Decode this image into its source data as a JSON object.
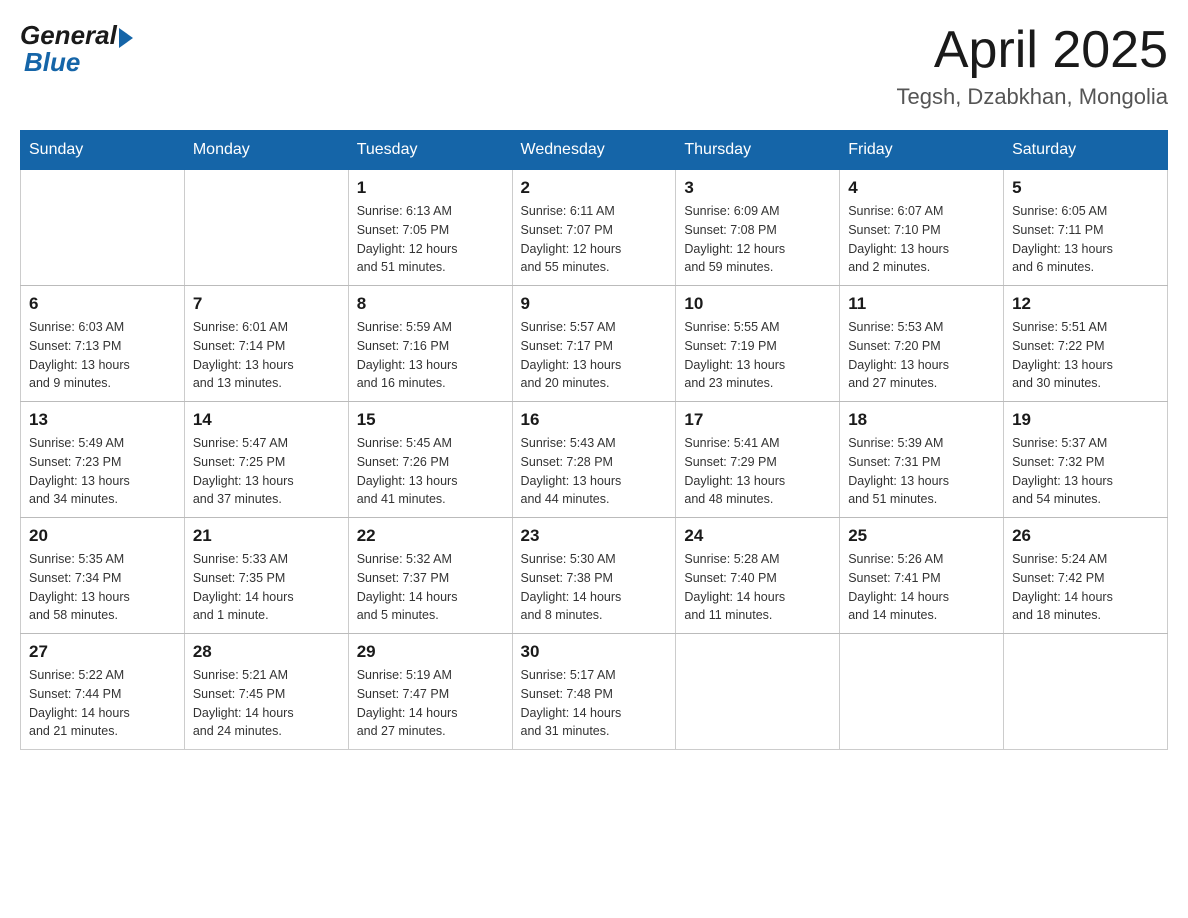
{
  "logo": {
    "general": "General",
    "blue": "Blue"
  },
  "title": "April 2025",
  "location": "Tegsh, Dzabkhan, Mongolia",
  "days_of_week": [
    "Sunday",
    "Monday",
    "Tuesday",
    "Wednesday",
    "Thursday",
    "Friday",
    "Saturday"
  ],
  "weeks": [
    [
      {
        "day": "",
        "info": ""
      },
      {
        "day": "",
        "info": ""
      },
      {
        "day": "1",
        "info": "Sunrise: 6:13 AM\nSunset: 7:05 PM\nDaylight: 12 hours\nand 51 minutes."
      },
      {
        "day": "2",
        "info": "Sunrise: 6:11 AM\nSunset: 7:07 PM\nDaylight: 12 hours\nand 55 minutes."
      },
      {
        "day": "3",
        "info": "Sunrise: 6:09 AM\nSunset: 7:08 PM\nDaylight: 12 hours\nand 59 minutes."
      },
      {
        "day": "4",
        "info": "Sunrise: 6:07 AM\nSunset: 7:10 PM\nDaylight: 13 hours\nand 2 minutes."
      },
      {
        "day": "5",
        "info": "Sunrise: 6:05 AM\nSunset: 7:11 PM\nDaylight: 13 hours\nand 6 minutes."
      }
    ],
    [
      {
        "day": "6",
        "info": "Sunrise: 6:03 AM\nSunset: 7:13 PM\nDaylight: 13 hours\nand 9 minutes."
      },
      {
        "day": "7",
        "info": "Sunrise: 6:01 AM\nSunset: 7:14 PM\nDaylight: 13 hours\nand 13 minutes."
      },
      {
        "day": "8",
        "info": "Sunrise: 5:59 AM\nSunset: 7:16 PM\nDaylight: 13 hours\nand 16 minutes."
      },
      {
        "day": "9",
        "info": "Sunrise: 5:57 AM\nSunset: 7:17 PM\nDaylight: 13 hours\nand 20 minutes."
      },
      {
        "day": "10",
        "info": "Sunrise: 5:55 AM\nSunset: 7:19 PM\nDaylight: 13 hours\nand 23 minutes."
      },
      {
        "day": "11",
        "info": "Sunrise: 5:53 AM\nSunset: 7:20 PM\nDaylight: 13 hours\nand 27 minutes."
      },
      {
        "day": "12",
        "info": "Sunrise: 5:51 AM\nSunset: 7:22 PM\nDaylight: 13 hours\nand 30 minutes."
      }
    ],
    [
      {
        "day": "13",
        "info": "Sunrise: 5:49 AM\nSunset: 7:23 PM\nDaylight: 13 hours\nand 34 minutes."
      },
      {
        "day": "14",
        "info": "Sunrise: 5:47 AM\nSunset: 7:25 PM\nDaylight: 13 hours\nand 37 minutes."
      },
      {
        "day": "15",
        "info": "Sunrise: 5:45 AM\nSunset: 7:26 PM\nDaylight: 13 hours\nand 41 minutes."
      },
      {
        "day": "16",
        "info": "Sunrise: 5:43 AM\nSunset: 7:28 PM\nDaylight: 13 hours\nand 44 minutes."
      },
      {
        "day": "17",
        "info": "Sunrise: 5:41 AM\nSunset: 7:29 PM\nDaylight: 13 hours\nand 48 minutes."
      },
      {
        "day": "18",
        "info": "Sunrise: 5:39 AM\nSunset: 7:31 PM\nDaylight: 13 hours\nand 51 minutes."
      },
      {
        "day": "19",
        "info": "Sunrise: 5:37 AM\nSunset: 7:32 PM\nDaylight: 13 hours\nand 54 minutes."
      }
    ],
    [
      {
        "day": "20",
        "info": "Sunrise: 5:35 AM\nSunset: 7:34 PM\nDaylight: 13 hours\nand 58 minutes."
      },
      {
        "day": "21",
        "info": "Sunrise: 5:33 AM\nSunset: 7:35 PM\nDaylight: 14 hours\nand 1 minute."
      },
      {
        "day": "22",
        "info": "Sunrise: 5:32 AM\nSunset: 7:37 PM\nDaylight: 14 hours\nand 5 minutes."
      },
      {
        "day": "23",
        "info": "Sunrise: 5:30 AM\nSunset: 7:38 PM\nDaylight: 14 hours\nand 8 minutes."
      },
      {
        "day": "24",
        "info": "Sunrise: 5:28 AM\nSunset: 7:40 PM\nDaylight: 14 hours\nand 11 minutes."
      },
      {
        "day": "25",
        "info": "Sunrise: 5:26 AM\nSunset: 7:41 PM\nDaylight: 14 hours\nand 14 minutes."
      },
      {
        "day": "26",
        "info": "Sunrise: 5:24 AM\nSunset: 7:42 PM\nDaylight: 14 hours\nand 18 minutes."
      }
    ],
    [
      {
        "day": "27",
        "info": "Sunrise: 5:22 AM\nSunset: 7:44 PM\nDaylight: 14 hours\nand 21 minutes."
      },
      {
        "day": "28",
        "info": "Sunrise: 5:21 AM\nSunset: 7:45 PM\nDaylight: 14 hours\nand 24 minutes."
      },
      {
        "day": "29",
        "info": "Sunrise: 5:19 AM\nSunset: 7:47 PM\nDaylight: 14 hours\nand 27 minutes."
      },
      {
        "day": "30",
        "info": "Sunrise: 5:17 AM\nSunset: 7:48 PM\nDaylight: 14 hours\nand 31 minutes."
      },
      {
        "day": "",
        "info": ""
      },
      {
        "day": "",
        "info": ""
      },
      {
        "day": "",
        "info": ""
      }
    ]
  ]
}
